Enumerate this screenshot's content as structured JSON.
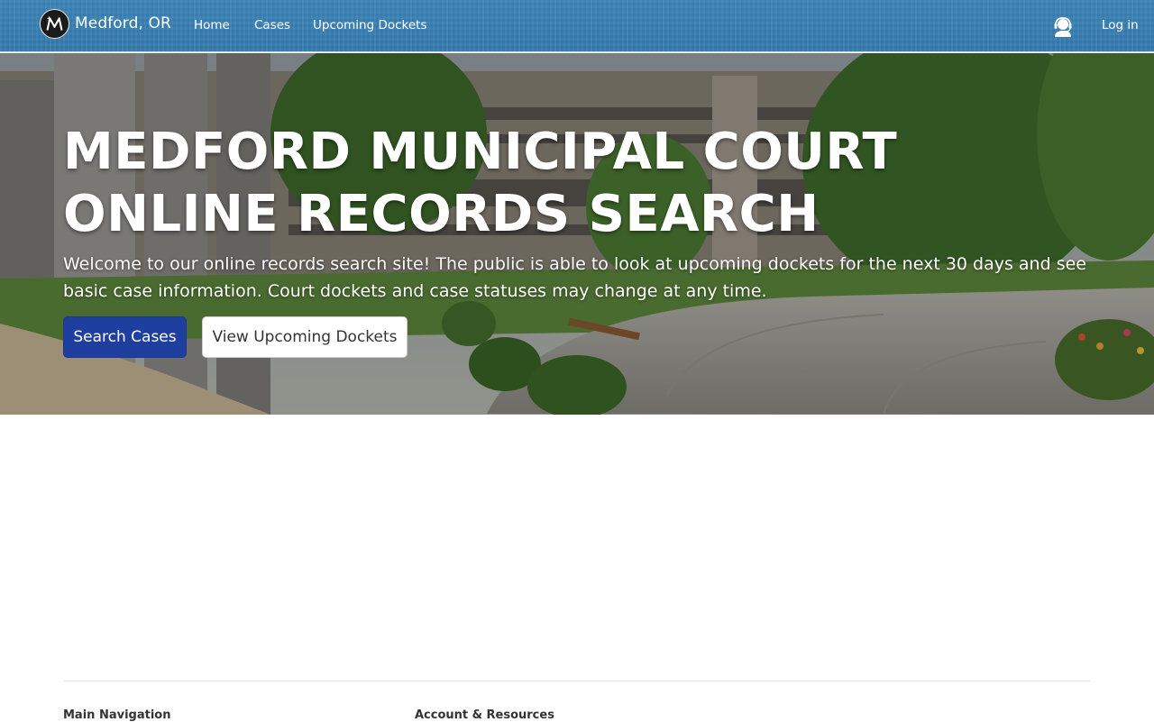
{
  "navbar": {
    "brand_name": "Medford, OR",
    "logo_icon": "medford-m-logo-icon",
    "links": [
      {
        "label": "Home"
      },
      {
        "label": "Cases"
      },
      {
        "label": "Upcoming Dockets"
      }
    ],
    "support_icon": "headset-support-icon",
    "login_label": "Log in"
  },
  "hero": {
    "title": "MEDFORD MUNICIPAL COURT ONLINE RECORDS SEARCH",
    "lead": "Welcome to our online records search site! The public is able to look at upcoming dockets for the next 30 days and see basic case information. Court dockets and case statuses may change at any time.",
    "primary_button": "Search Cases",
    "secondary_button": "View Upcoming Dockets"
  },
  "footer": {
    "sections": [
      {
        "heading": "Main Navigation"
      },
      {
        "heading": "Account & Resources"
      }
    ]
  },
  "colors": {
    "navbar": "#3479ad",
    "primary_button": "#1f3fa0",
    "text_dark": "#333333"
  }
}
